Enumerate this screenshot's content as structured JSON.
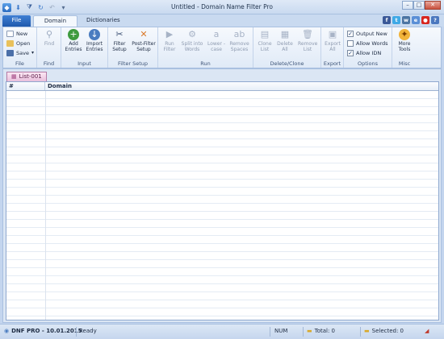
{
  "window": {
    "title": "Untitled - Domain Name Filter Pro",
    "controls": {
      "minimize": "–",
      "maximize": "□",
      "close": "✕"
    }
  },
  "quick_access": [
    "app-icon",
    "down-arrow-icon",
    "filter-icon",
    "refresh-icon",
    "undo-icon",
    "customize-icon"
  ],
  "tabs": {
    "file": "File",
    "domain_filter": "Domain Filter",
    "dictionaries": "Dictionaries"
  },
  "social": [
    {
      "name": "facebook-icon",
      "glyph": "f",
      "color": "#3b5998"
    },
    {
      "name": "twitter-icon",
      "glyph": "t",
      "color": "#3fa9e6"
    },
    {
      "name": "vk-icon",
      "glyph": "w",
      "color": "#4c75a3"
    },
    {
      "name": "website-icon",
      "glyph": "e",
      "color": "#5b8fd6"
    },
    {
      "name": "youtube-icon",
      "glyph": "●",
      "color": "#d8261f"
    },
    {
      "name": "help-icon",
      "glyph": "?",
      "color": "#4b78bf"
    }
  ],
  "ribbon": {
    "file_group": {
      "label": "File",
      "new": "New",
      "open": "Open",
      "save": "Save"
    },
    "find_group": {
      "label": "Find",
      "find": "Find"
    },
    "input_group": {
      "label": "Input",
      "add_entries": "Add Entries",
      "import_entries": "Import Entries"
    },
    "filter_setup_group": {
      "label": "Filter Setup",
      "filter_setup": "Filter Setup",
      "post_filter_setup": "Post-Filter Setup"
    },
    "run_group": {
      "label": "Run",
      "run_filter": "Run Filter",
      "split_into_words": "Split into Words",
      "lower_case": "Lower -case",
      "remove_spaces": "Remove Spaces"
    },
    "delete_clone_group": {
      "label": "Delete/Clone",
      "clone_list": "Clone List",
      "delete_all": "Delete All",
      "remove_list": "Remove List"
    },
    "export_group": {
      "label": "Export",
      "export_all": "Export All"
    },
    "options_group": {
      "label": "Options",
      "output_new": {
        "label": "Output New",
        "checked": true
      },
      "allow_words": {
        "label": "Allow Words",
        "checked": false
      },
      "allow_idn": {
        "label": "Allow IDN",
        "checked": true
      }
    },
    "misc_group": {
      "label": "Misc",
      "more_tools": "More Tools"
    }
  },
  "document": {
    "tab_label": "List-001",
    "columns": {
      "index": "#",
      "domain": "Domain"
    }
  },
  "status_bar": {
    "product": "DNF PRO - 10.01.2015",
    "state": "Ready",
    "num": "NUM",
    "total": "Total: 0",
    "selected": "Selected: 0"
  }
}
